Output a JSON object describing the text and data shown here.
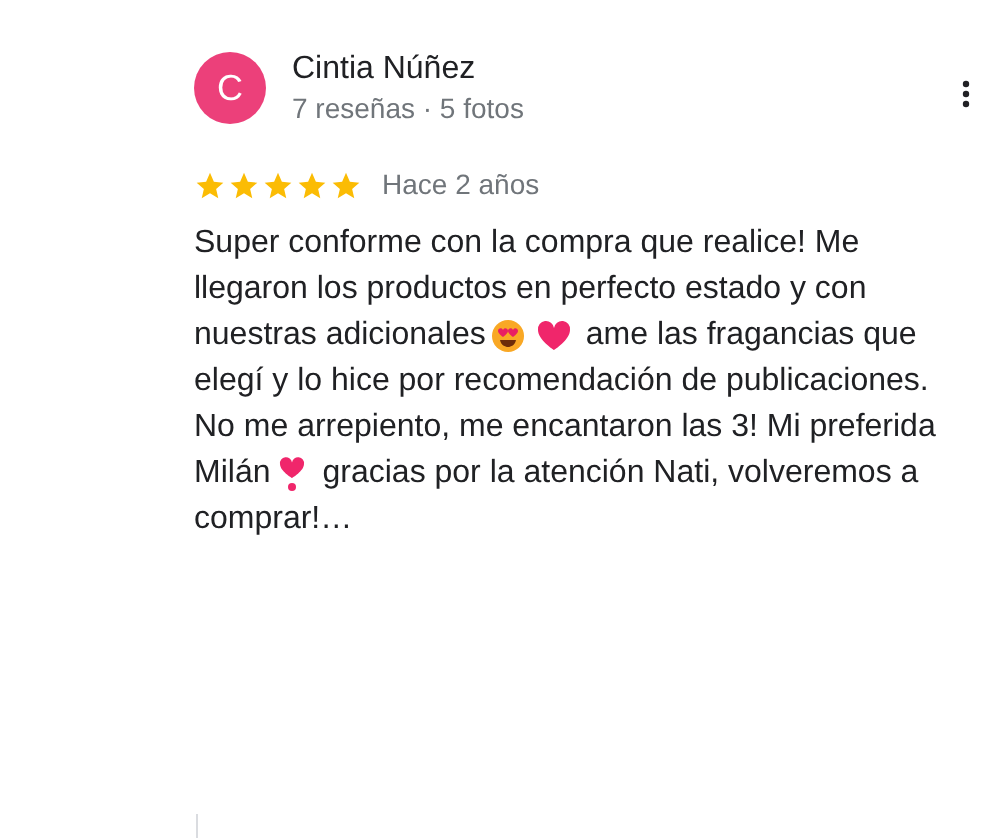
{
  "review": {
    "avatar_letter": "C",
    "author": "Cintia Núñez",
    "author_meta": "7 reseñas · 5 fotos",
    "stars": 5,
    "time": "Hace 2 años",
    "lines": [
      [
        {
          "kind": "text",
          "text": "Super conforme con la compra que realice! Me"
        }
      ],
      [
        {
          "kind": "text",
          "text": "llegaron los productos en perfecto estado y con"
        }
      ],
      [
        {
          "kind": "text",
          "text": "nuestras adicionales"
        },
        {
          "kind": "hearteyes"
        },
        {
          "kind": "heart"
        },
        {
          "kind": "text",
          "text": "ame las fragancias que"
        }
      ],
      [
        {
          "kind": "text",
          "text": "elegí y lo hice por recomendación de publicaciones."
        }
      ],
      [
        {
          "kind": "text",
          "text": "No me arrepiento, me encantaron las 3! Mi preferida"
        }
      ],
      [
        {
          "kind": "text",
          "text": "Milán"
        },
        {
          "kind": "heartmark"
        },
        {
          "kind": "text",
          "text": "gracias por la atención Nati, volveremos a"
        }
      ],
      [
        {
          "kind": "text",
          "text": "comprar!…"
        }
      ]
    ]
  }
}
